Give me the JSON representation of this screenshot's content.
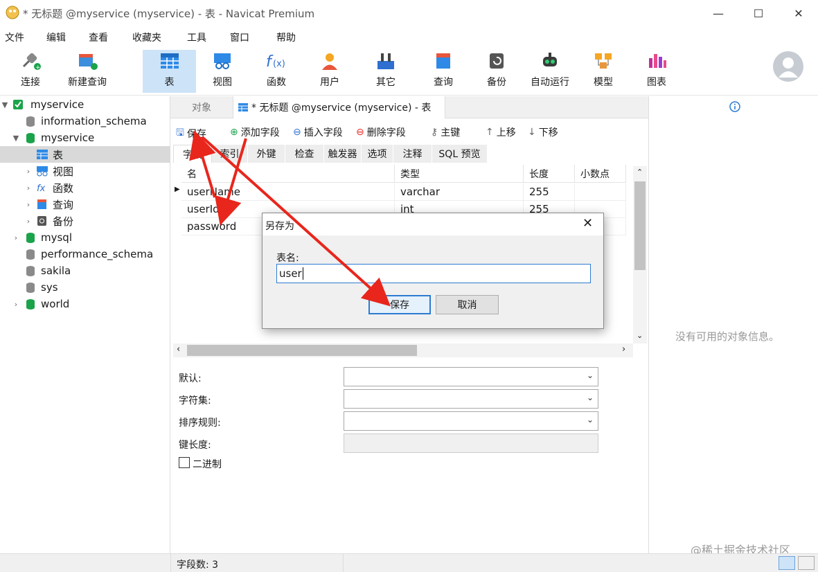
{
  "window": {
    "title": "* 无标题 @myservice (myservice) - 表 - Navicat Premium",
    "minimize": "—",
    "maximize": "☐",
    "close": "✕"
  },
  "menu": [
    "文件",
    "编辑",
    "查看",
    "收藏夹",
    "工具",
    "窗口",
    "帮助"
  ],
  "toolbar": {
    "connect": "连接",
    "new_query": "新建查询",
    "table": "表",
    "view": "视图",
    "function": "函数",
    "user": "用户",
    "other": "其它",
    "query": "查询",
    "backup": "备份",
    "automation": "自动运行",
    "model": "模型",
    "chart": "图表"
  },
  "sidebar": {
    "root": "myservice",
    "items": [
      "information_schema",
      "myservice",
      "表",
      "视图",
      "函数",
      "查询",
      "备份",
      "mysql",
      "performance_schema",
      "sakila",
      "sys",
      "world"
    ]
  },
  "tabs": {
    "objects": "对象",
    "editor": "* 无标题 @myservice (myservice) - 表"
  },
  "actions": {
    "save": "保存",
    "add_field": "添加字段",
    "insert_field": "插入字段",
    "delete_field": "删除字段",
    "primary_key": "主键",
    "move_up": "上移",
    "move_down": "下移"
  },
  "subtabs": [
    "字段",
    "索引",
    "外键",
    "检查",
    "触发器",
    "选项",
    "注释",
    "SQL 预览"
  ],
  "grid": {
    "headers": [
      "名",
      "类型",
      "长度",
      "小数点"
    ],
    "rows": [
      {
        "name": "userName",
        "type": "varchar",
        "length": "255"
      },
      {
        "name": "userId",
        "type": "int",
        "length": "255"
      },
      {
        "name": "password",
        "type": "",
        "length": ""
      }
    ]
  },
  "props": {
    "default": "默认:",
    "charset": "字符集:",
    "collation": "排序规则:",
    "key_length": "键长度:",
    "binary": "二进制"
  },
  "right_panel": {
    "empty": "没有可用的对象信息。"
  },
  "status": {
    "field_count": "字段数: 3",
    "watermark": "@稀土掘金技术社区"
  },
  "dialog": {
    "title": "另存为",
    "label": "表名:",
    "value": "user",
    "save": "保存",
    "cancel": "取消"
  },
  "colors": {
    "accent": "#2b7bd1",
    "db_green": "#1aa34a",
    "db_gray": "#8a8a8a",
    "arrow_red": "#e8261c",
    "selected_toolbar": "#cde3f7"
  }
}
